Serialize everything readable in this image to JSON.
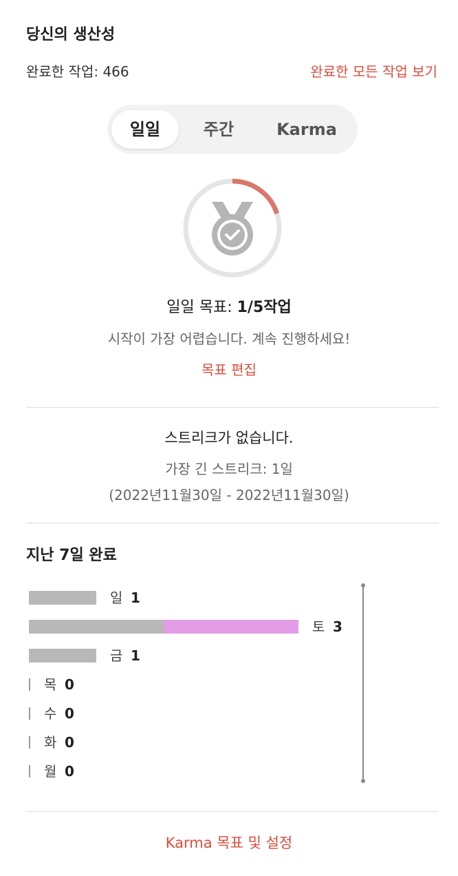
{
  "header": {
    "title": "당신의 생산성",
    "completed_label": "완료한 작업: 466",
    "view_all_link": "완료한 모든 작업 보기"
  },
  "tabs": [
    {
      "label": "일일",
      "active": true
    },
    {
      "label": "주간",
      "active": false
    },
    {
      "label": "Karma",
      "active": false
    }
  ],
  "daily_goal": {
    "progress_fraction": 0.2,
    "completed": 1,
    "target": 5,
    "label_prefix": "일일 목표: ",
    "label_value": "1/5작업",
    "message": "시작이 가장 어렵습니다. 계속 진행하세요!",
    "edit_link": "목표 편집",
    "icon": "medal-check-icon",
    "colors": {
      "progress": "#d9776b",
      "track": "#e5e5e5",
      "icon": "#b5b5b5"
    }
  },
  "streak": {
    "current": "스트리크가 없습니다.",
    "longest": "가장 긴 스트리크: 1일",
    "longest_range": "(2022년11월30일 - 2022년11월30일)"
  },
  "last7": {
    "title": "지난 7일 완료",
    "chart_data": {
      "type": "bar",
      "orientation": "horizontal",
      "goal_line": 5,
      "colors": {
        "base": "#b8b8b8",
        "extra": "#e29de6",
        "goal_line": "#8a8a8a"
      },
      "days": [
        {
          "label": "일",
          "count": "1",
          "value": 1,
          "extra": 0
        },
        {
          "label": "토",
          "count": "3",
          "value": 2,
          "extra": 2
        },
        {
          "label": "금",
          "count": "1",
          "value": 1,
          "extra": 0
        },
        {
          "label": "목",
          "count": "0",
          "value": 0,
          "extra": 0
        },
        {
          "label": "수",
          "count": "0",
          "value": 0,
          "extra": 0
        },
        {
          "label": "화",
          "count": "0",
          "value": 0,
          "extra": 0
        },
        {
          "label": "월",
          "count": "0",
          "value": 0,
          "extra": 0
        }
      ]
    }
  },
  "footer": {
    "karma_link": "Karma 목표 및 설정"
  }
}
